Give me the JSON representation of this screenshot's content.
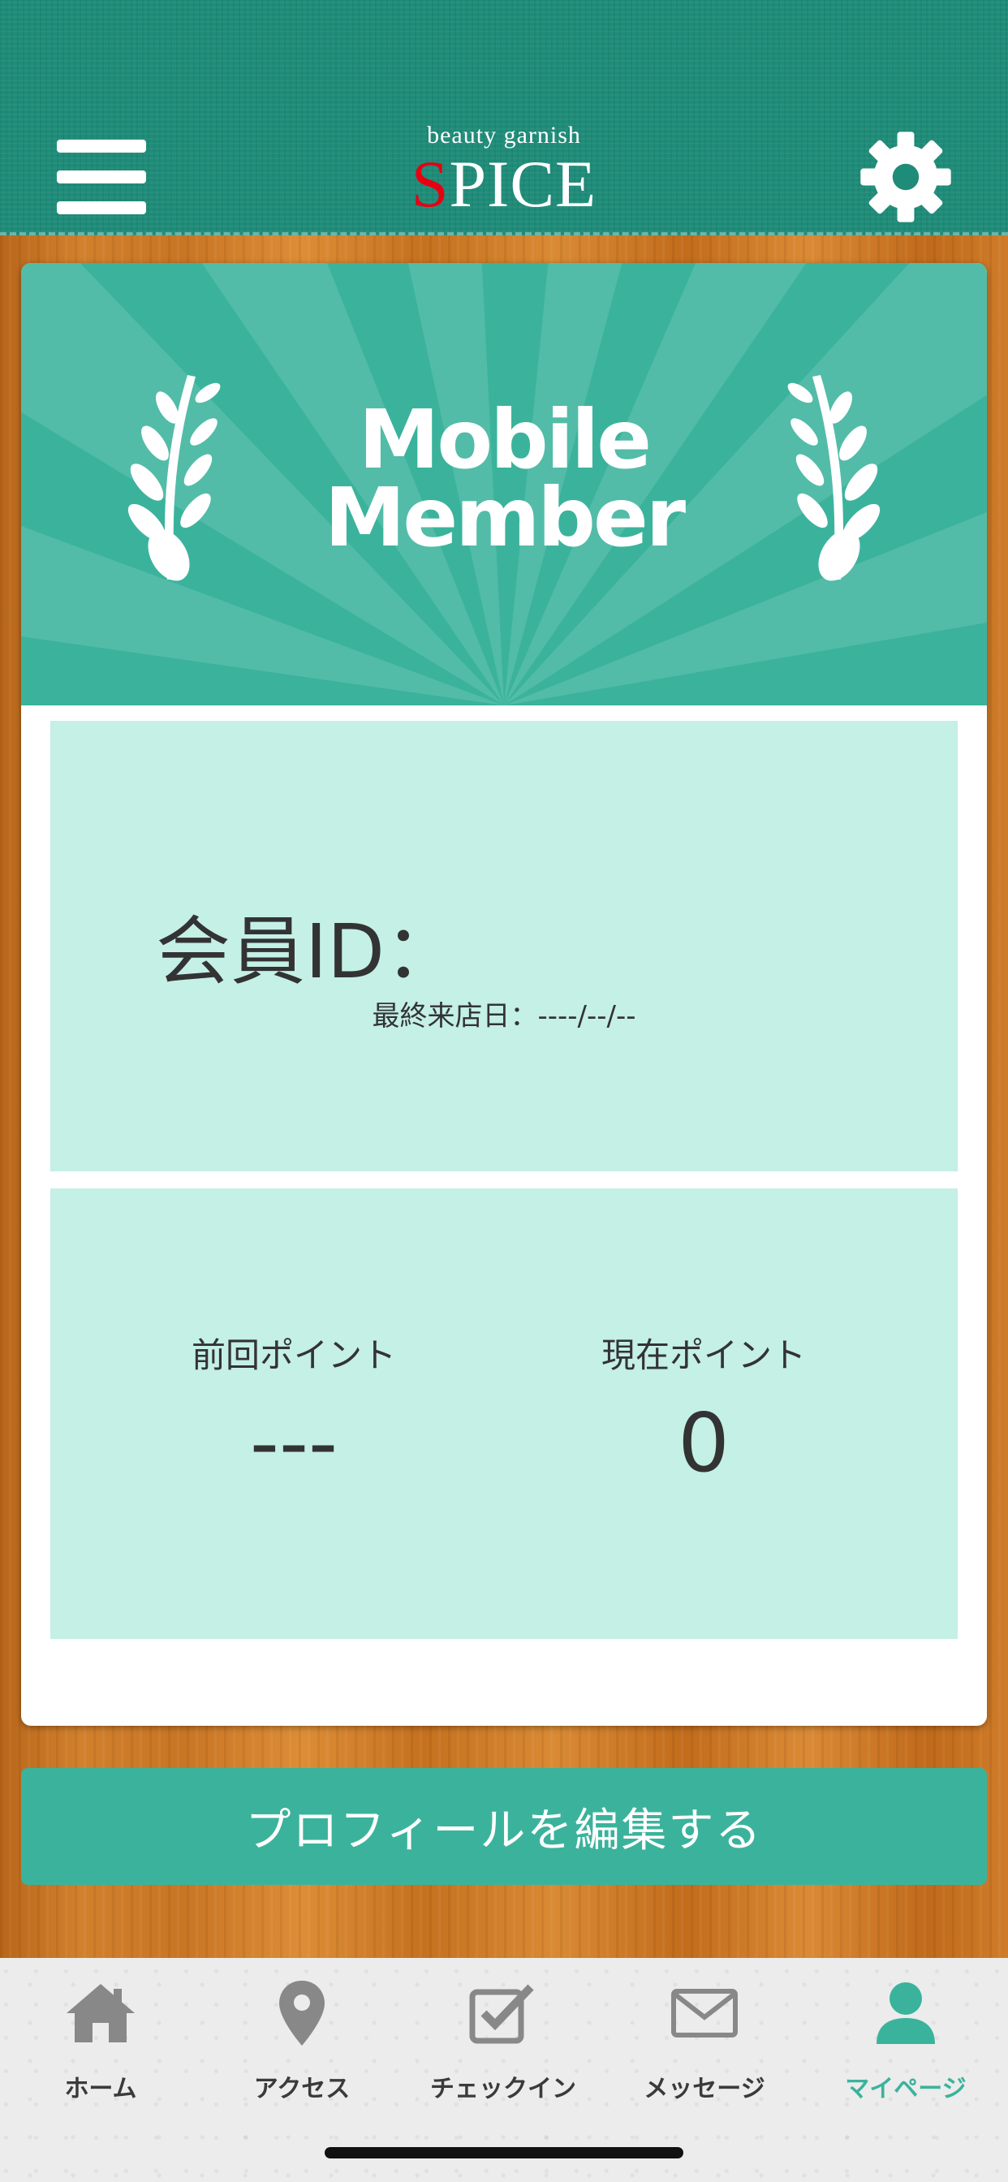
{
  "header": {
    "logo_sub": "beauty garnish",
    "logo_first_letter": "S",
    "logo_rest": "PICE"
  },
  "banner": {
    "title_line1": "Mobile",
    "title_line2": "Member"
  },
  "member": {
    "id_label": "会員ID：",
    "last_visit": "最終来店日：----/--/--"
  },
  "points": {
    "previous_label": "前回ポイント",
    "previous_value": "---",
    "current_label": "現在ポイント",
    "current_value": "0"
  },
  "edit_button": "プロフィールを編集する",
  "tabs": [
    {
      "label": "ホーム",
      "icon": "home-icon"
    },
    {
      "label": "アクセス",
      "icon": "map-pin-icon"
    },
    {
      "label": "チェックイン",
      "icon": "checkbox-icon"
    },
    {
      "label": "メッセージ",
      "icon": "envelope-icon"
    },
    {
      "label": "マイページ",
      "icon": "user-icon",
      "active": true
    }
  ],
  "colors": {
    "header": "#1f8c79",
    "accent": "#3bb39c",
    "panel": "#c4f0e6",
    "logo_red": "#e60012"
  }
}
